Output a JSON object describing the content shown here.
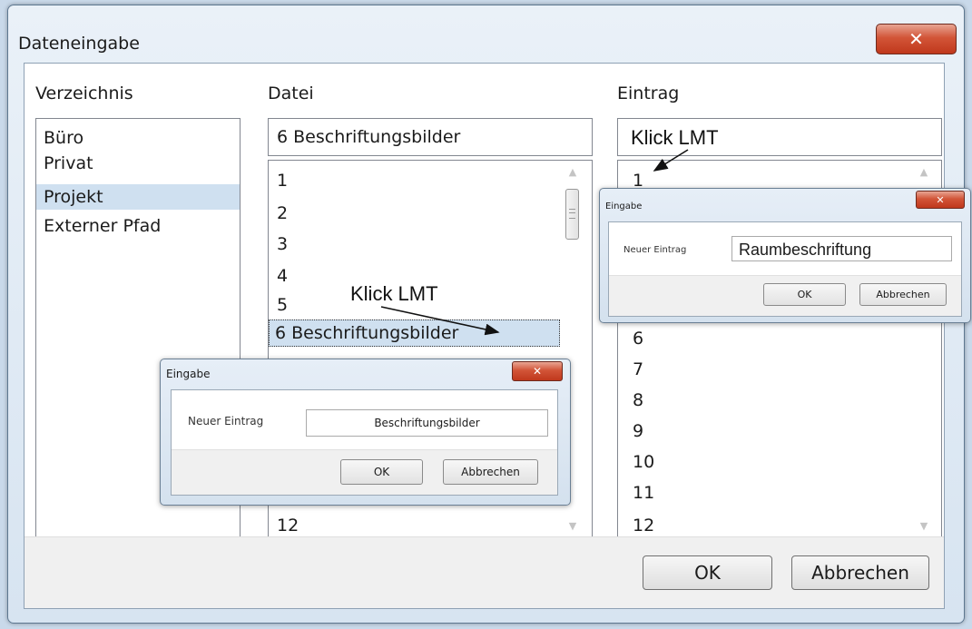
{
  "window": {
    "title": "Dateneingabe",
    "close_glyph": "✕"
  },
  "columns": {
    "verzeichnis": {
      "label": "Verzeichnis",
      "items": [
        "Büro",
        "Privat",
        "Projekt",
        "Externer Pfad"
      ],
      "selected": "Projekt"
    },
    "datei": {
      "label": "Datei",
      "current_value": "6 Beschriftungsbilder",
      "items": [
        "1",
        "2",
        "3",
        "4",
        "5",
        "6 Beschriftungsbilder",
        "12"
      ],
      "selected": "6 Beschriftungsbilder"
    },
    "eintrag": {
      "label": "Eintrag",
      "current_value": "Klick LMT",
      "items": [
        "1",
        "6",
        "7",
        "8",
        "9",
        "10",
        "11",
        "12"
      ]
    }
  },
  "annotations": {
    "datei_click": "Klick LMT"
  },
  "dialog_left": {
    "title": "Eingabe",
    "field_label": "Neuer Eintrag",
    "field_value": "Beschriftungsbilder",
    "ok": "OK",
    "cancel": "Abbrechen"
  },
  "dialog_right": {
    "title": "Eingabe",
    "field_label": "Neuer Eintrag",
    "field_value": "Raumbeschriftung",
    "ok": "OK",
    "cancel": "Abbrechen"
  },
  "footer": {
    "ok": "OK",
    "cancel": "Abbrechen"
  },
  "colors": {
    "selection": "#cfe0f0",
    "close_button": "#c94a2f"
  }
}
